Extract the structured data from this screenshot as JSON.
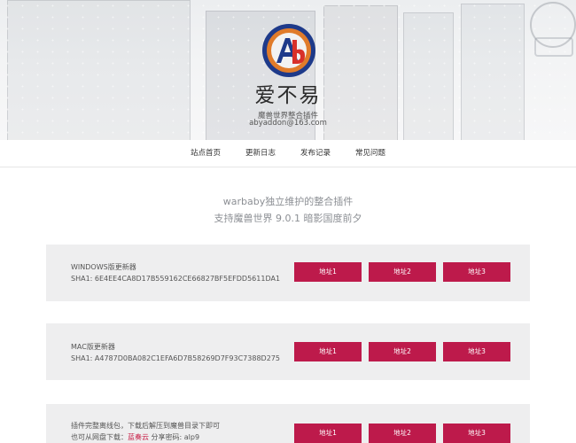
{
  "header": {
    "logo_text": "AB",
    "brand_name": "爱不易",
    "subtitle": "魔兽世界整合插件",
    "email": "abyaddon@163.com",
    "colors": {
      "logo_blue": "#1e3a8a",
      "logo_orange": "#e07b2a",
      "logo_red": "#d8302a"
    }
  },
  "nav": {
    "items": [
      "站点首页",
      "更新日志",
      "发布记录",
      "常见问题"
    ]
  },
  "intro": {
    "line1": "warbaby独立维护的整合插件",
    "line2": "支持魔兽世界 9.0.1 暗影国度前夕"
  },
  "cards": [
    {
      "title": "WINDOWS版更新器",
      "sha": "SHA1: 6E4EE4CA8D17B559162CE66827BF5EFDD5611DA1",
      "buttons": [
        "地址1",
        "地址2",
        "地址3"
      ]
    },
    {
      "title": "MAC版更新器",
      "sha": "SHA1: A4787D0BA082C1EFA6D7B58269D7F93C7388D275",
      "buttons": [
        "地址1",
        "地址2",
        "地址3"
      ]
    },
    {
      "line1": "插件完整离线包，下载后解压到魔兽目录下即可",
      "line2_prefix": "也可从网盘下载：",
      "line2_link": "蓝奏云",
      "line2_suffix": " 分享密码: alp9",
      "buttons": [
        "地址1",
        "地址2",
        "地址3"
      ]
    }
  ],
  "colors": {
    "button_bg": "#bd1a4b",
    "card_bg": "#eeeeef"
  }
}
